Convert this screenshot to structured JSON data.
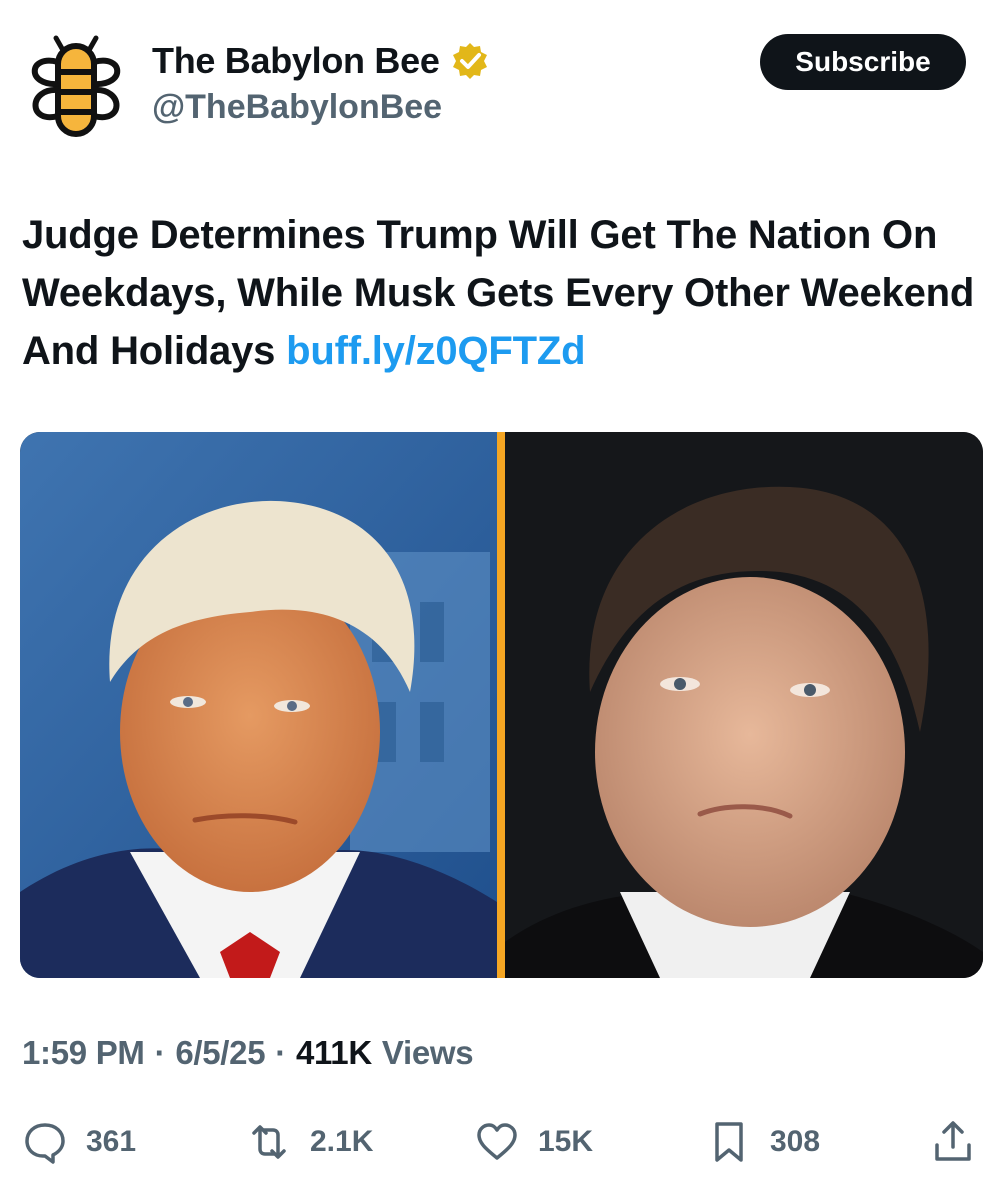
{
  "account": {
    "display_name": "The Babylon Bee",
    "handle": "@TheBabylonBee",
    "verified": true,
    "verified_color": "#e2b719",
    "avatar_icon": "bee-logo-icon",
    "brand_yellow": "#f6b53c"
  },
  "header": {
    "subscribe_label": "Subscribe"
  },
  "tweet": {
    "text": "Judge Determines Trump Will Get The Nation On Weekdays, While Musk Gets Every Other Weekend And Holidays",
    "link_text": "buff.ly/z0QFTZd",
    "link_color": "#1d9bf0"
  },
  "media": {
    "divider_color": "#f5a623",
    "panels": [
      "left-portrait",
      "right-portrait"
    ]
  },
  "meta": {
    "time": "1:59 PM",
    "separator": "·",
    "date": "6/5/25",
    "views_count": "411K",
    "views_label": "Views"
  },
  "actions": {
    "replies": "361",
    "reposts": "2.1K",
    "likes": "15K",
    "bookmarks": "308"
  }
}
